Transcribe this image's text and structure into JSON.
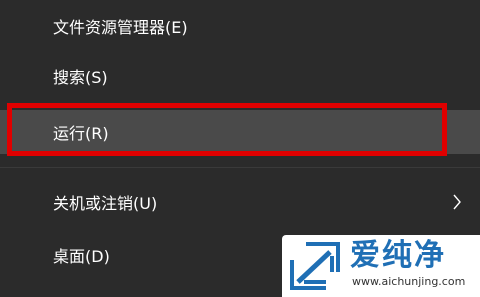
{
  "menu": {
    "items": [
      {
        "label": "文件资源管理器(E)"
      },
      {
        "label": "搜索(S)"
      },
      {
        "label": "运行(R)"
      },
      {
        "label": "关机或注销(U)"
      },
      {
        "label": "桌面(D)"
      }
    ]
  },
  "watermark": {
    "title": "爱纯净",
    "url": "www.aichunjing.com"
  },
  "colors": {
    "menu_background": "#2b2b2b",
    "highlighted_item": "#4a4a4a",
    "annotation_box": "#e00000",
    "watermark_accent": "#1f6fb5"
  },
  "icons": {
    "submenu_arrow": "chevron-right-icon",
    "watermark_logo": "logo-icon"
  }
}
